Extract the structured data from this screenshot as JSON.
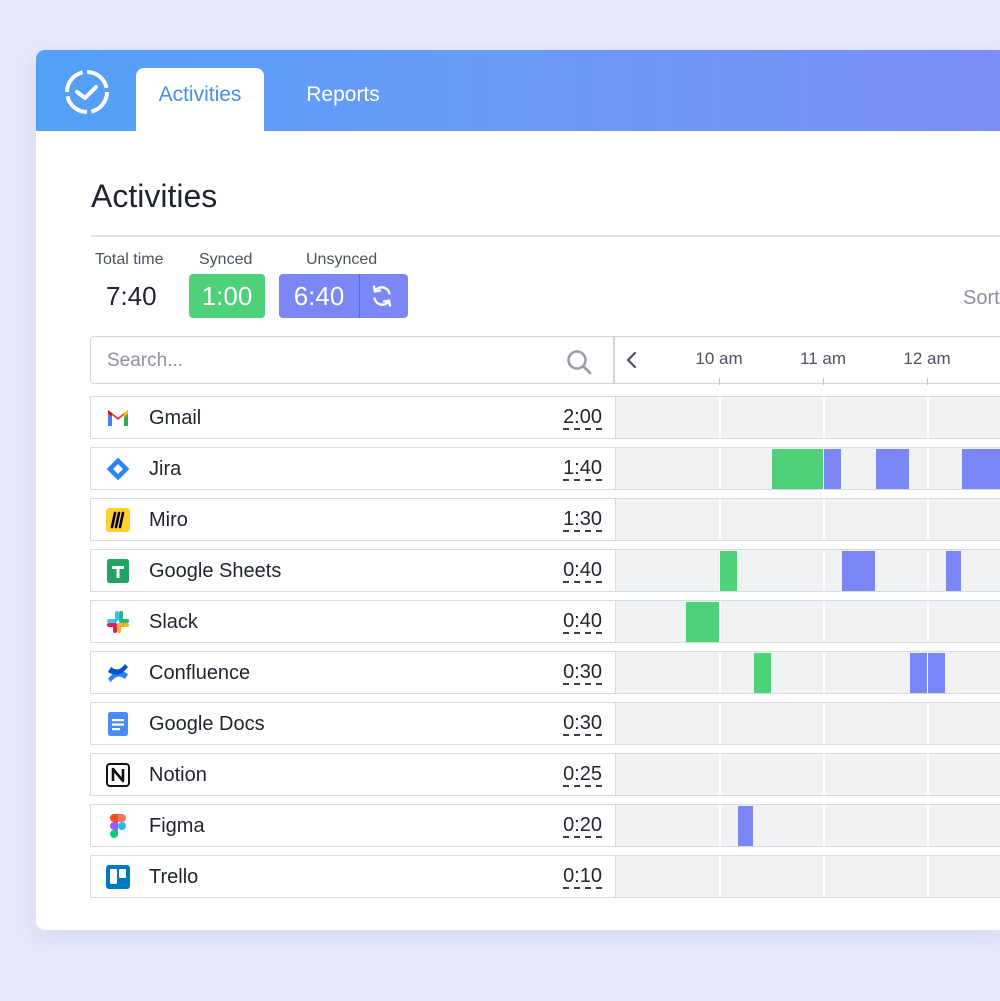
{
  "app": {
    "logo_icon": "stopwatch-icon",
    "tabs": [
      {
        "label": "Activities",
        "active": true
      },
      {
        "label": "Reports",
        "active": false
      }
    ]
  },
  "page": {
    "title": "Activities"
  },
  "summary": {
    "total_label": "Total time",
    "total_value": "7:40",
    "synced_label": "Synced",
    "synced_value": "1:00",
    "unsynced_label": "Unsynced",
    "unsynced_value": "6:40",
    "sync_icon": "refresh-icon",
    "sort_label": "Sort"
  },
  "search": {
    "placeholder": "Search...",
    "icon": "search-icon"
  },
  "timeline": {
    "hours": [
      {
        "label": "10 am",
        "value": 10
      },
      {
        "label": "11 am",
        "value": 11
      },
      {
        "label": "12 am",
        "value": 12
      }
    ],
    "visible_start": 9,
    "prev_icon": "chevron-left-icon"
  },
  "colors": {
    "synced": "#4fd17a",
    "unsynced": "#7b87f7",
    "header_start": "#53a0f7",
    "header_end": "#7c8ff9"
  },
  "activities": [
    {
      "name": "Gmail",
      "icon": "gmail-icon",
      "time": "2:00",
      "segments": []
    },
    {
      "name": "Jira",
      "icon": "jira-icon",
      "time": "1:40",
      "segments": [
        {
          "start": 10.5,
          "end": 11.0,
          "status": "synced"
        },
        {
          "start": 11.0,
          "end": 11.17,
          "status": "unsynced"
        },
        {
          "start": 11.5,
          "end": 11.83,
          "status": "unsynced"
        },
        {
          "start": 12.33,
          "end": 12.8,
          "status": "unsynced"
        }
      ]
    },
    {
      "name": "Miro",
      "icon": "miro-icon",
      "time": "1:30",
      "segments": []
    },
    {
      "name": "Google Sheets",
      "icon": "google-sheets-icon",
      "time": "0:40",
      "segments": [
        {
          "start": 10.0,
          "end": 10.17,
          "status": "synced"
        },
        {
          "start": 11.17,
          "end": 11.5,
          "status": "unsynced"
        },
        {
          "start": 12.17,
          "end": 12.33,
          "status": "unsynced"
        }
      ]
    },
    {
      "name": "Slack",
      "icon": "slack-icon",
      "time": "0:40",
      "segments": [
        {
          "start": 9.67,
          "end": 10.0,
          "status": "synced"
        }
      ]
    },
    {
      "name": "Confluence",
      "icon": "confluence-icon",
      "time": "0:30",
      "segments": [
        {
          "start": 10.33,
          "end": 10.5,
          "status": "synced"
        },
        {
          "start": 11.83,
          "end": 12.0,
          "status": "unsynced"
        },
        {
          "start": 12.0,
          "end": 12.17,
          "status": "unsynced"
        }
      ]
    },
    {
      "name": "Google Docs",
      "icon": "google-docs-icon",
      "time": "0:30",
      "segments": []
    },
    {
      "name": "Notion",
      "icon": "notion-icon",
      "time": "0:25",
      "segments": []
    },
    {
      "name": "Figma",
      "icon": "figma-icon",
      "time": "0:20",
      "segments": [
        {
          "start": 10.17,
          "end": 10.33,
          "status": "unsynced"
        }
      ]
    },
    {
      "name": "Trello",
      "icon": "trello-icon",
      "time": "0:10",
      "segments": []
    }
  ]
}
